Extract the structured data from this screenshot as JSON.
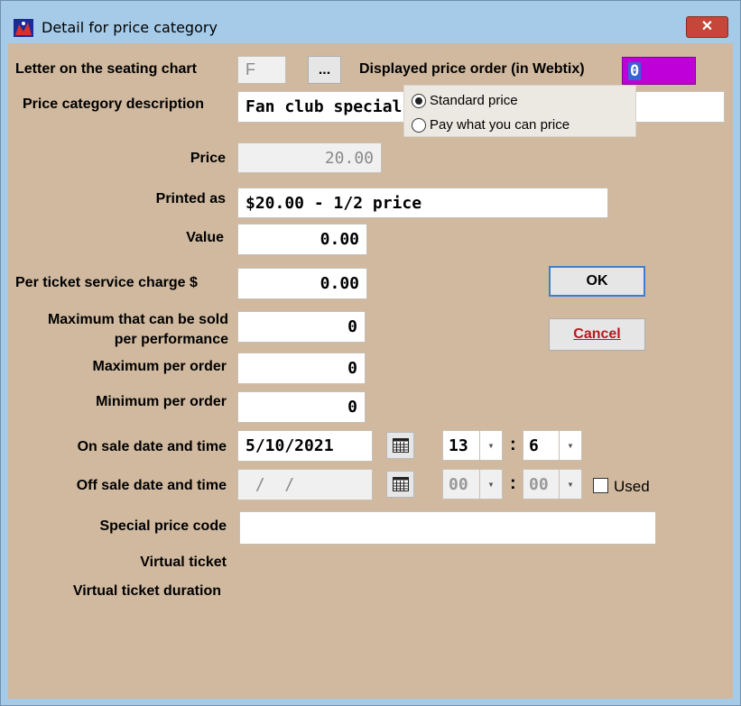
{
  "window": {
    "title": "Detail for price category",
    "close_symbol": "✕"
  },
  "labels": {
    "letter": "Letter on the seating chart",
    "price_order": "Displayed price order (in Webtix)",
    "description": "Price category description",
    "price": "Price",
    "printed_as": "Printed as",
    "value": "Value",
    "service_charge": "Per ticket service charge  $",
    "max_sold_1": "Maximum that can be sold",
    "max_sold_2": "per performance",
    "max_order": "Maximum per order",
    "min_order": "Minimum per order",
    "on_sale": "On sale date and time",
    "off_sale": "Off sale date and time",
    "special_code": "Special price code",
    "virtual_ticket": "Virtual ticket",
    "virtual_duration": "Virtual ticket duration"
  },
  "fields": {
    "letter": "F",
    "letter_browse": "...",
    "price_order": "0",
    "description": "Fan club special",
    "price": "20.00",
    "printed_as": "$20.00 - 1/2 price",
    "value": "0.00",
    "service_charge": "0.00",
    "max_sold": "0",
    "max_order": "0",
    "min_order": "0",
    "on_sale_date": "5/10/2021",
    "on_sale_hour": "13",
    "on_sale_minute": "6",
    "off_sale_date": " /  /",
    "off_sale_hour": "00",
    "off_sale_minute": "00",
    "special_code": ""
  },
  "radio": {
    "standard": "Standard price",
    "pwyc": "Pay what you can price",
    "selected": "standard"
  },
  "checkbox": {
    "used_label": "Used",
    "used_checked": false
  },
  "buttons": {
    "ok": "OK",
    "cancel": "Cancel"
  },
  "colors": {
    "background": "#d0b99f",
    "price_order_field": "#c000d8",
    "titlebar": "#a6cbe8",
    "close": "#c7463a"
  },
  "icons": {
    "app": "theater-seats-icon",
    "calendar": "calendar-icon",
    "dropdown": "chevron-down-icon"
  }
}
